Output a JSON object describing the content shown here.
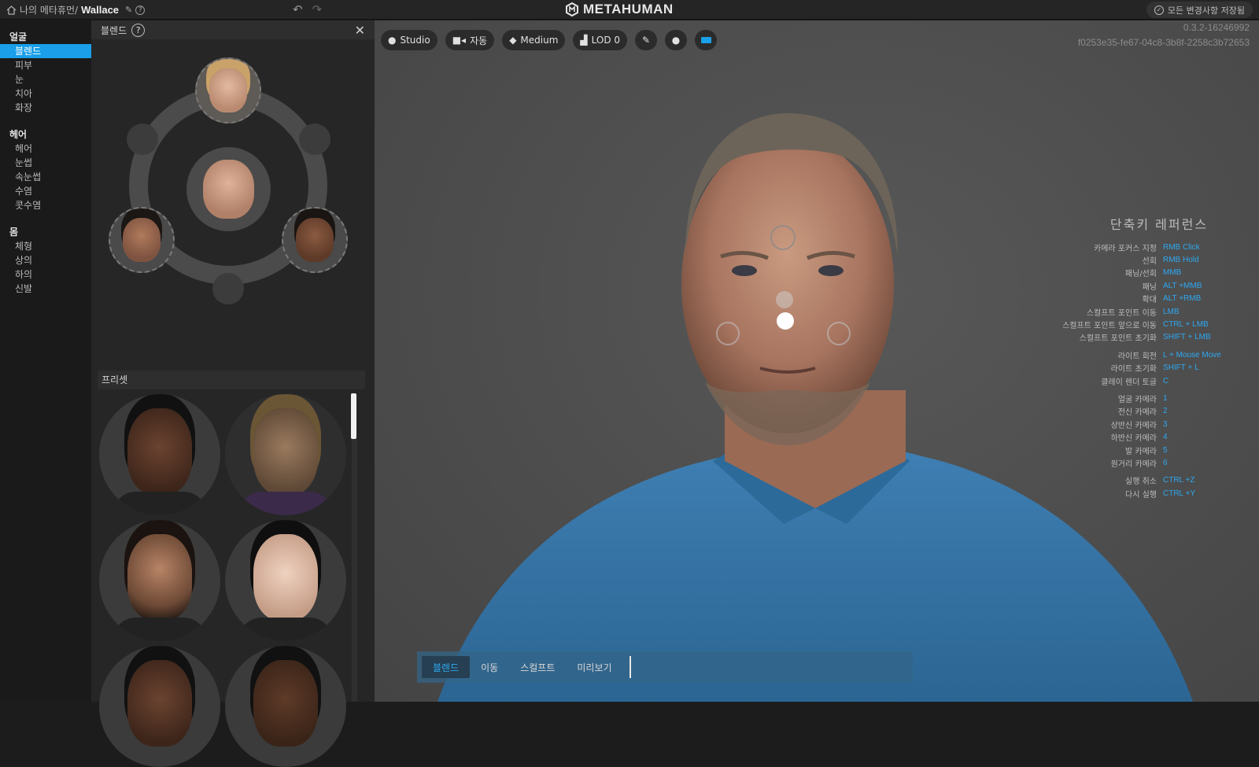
{
  "topbar": {
    "breadcrumb_root": "나의 메타휴먼/",
    "character_name": "Wallace",
    "logo_text": "METAHUMAN",
    "save_status": "모든 변경사항 저장됨"
  },
  "sidebar": {
    "sections": [
      {
        "title": "얼굴",
        "items": [
          "블렌드",
          "피부",
          "눈",
          "치아",
          "화장"
        ]
      },
      {
        "title": "헤어",
        "items": [
          "헤어",
          "눈썹",
          "속눈썹",
          "수염",
          "콧수염"
        ]
      },
      {
        "title": "몸",
        "items": [
          "체형",
          "상의",
          "하의",
          "신발"
        ]
      }
    ],
    "active_item": "블렌드"
  },
  "blend_panel": {
    "title": "블렌드",
    "help_icon": "question-icon",
    "close_icon": "close-icon",
    "presets_title": "프리셋"
  },
  "viewport": {
    "toolbar": {
      "lighting": "Studio",
      "camera": "자동",
      "quality": "Medium",
      "lod": "LOD 0"
    },
    "version": "0.3.2-16246992",
    "build_hash": "f0253e35-fe67-04c8-3b8f-2258c3b72653",
    "shortcuts_title": "단축키 레퍼런스",
    "shortcut_groups": [
      [
        {
          "k": "카메라 포커스 지정",
          "v": "RMB Click"
        },
        {
          "k": "선회",
          "v": "RMB Hold"
        },
        {
          "k": "패닝/선회",
          "v": "MMB"
        },
        {
          "k": "패닝",
          "v": "ALT +MMB"
        },
        {
          "k": "확대",
          "v": "ALT +RMB"
        },
        {
          "k": "스컬프트 포인트 이동",
          "v": "LMB"
        },
        {
          "k": "스컬프트 포인트 앞으로 이동",
          "v": "CTRL + LMB"
        },
        {
          "k": "스컬프트 포인트 초기화",
          "v": "SHIFT + LMB"
        }
      ],
      [
        {
          "k": "라이트 회전",
          "v": "L + Mouse Move"
        },
        {
          "k": "라이트 초기화",
          "v": "SHIFT + L"
        },
        {
          "k": "클레이 렌더 토글",
          "v": "C"
        }
      ],
      [
        {
          "k": "얼굴 카메라",
          "v": "1"
        },
        {
          "k": "전신 카메라",
          "v": "2"
        },
        {
          "k": "상반신 카메라",
          "v": "3"
        },
        {
          "k": "하반신 카메라",
          "v": "4"
        },
        {
          "k": "발 카메라",
          "v": "5"
        },
        {
          "k": "원거리 카메라",
          "v": "6"
        }
      ],
      [
        {
          "k": "실행 취소",
          "v": "CTRL +Z"
        },
        {
          "k": "다시 실행",
          "v": "CTRL +Y"
        }
      ]
    ],
    "modes": [
      "블렌드",
      "이동",
      "스컬프트",
      "미리보기"
    ],
    "active_mode": "블렌드"
  }
}
